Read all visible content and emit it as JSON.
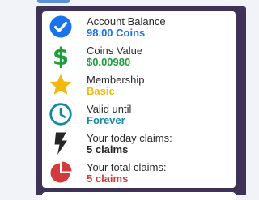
{
  "colors": {
    "page_bg": "#f1f3f8",
    "panel_bg": "#3e3256",
    "card_bg": "#ffffff",
    "blue": "#1a73e8",
    "green": "#1f9d3a",
    "yellow": "#f2b90c",
    "teal": "#138aa3",
    "dark": "#262626",
    "red": "#d23b3b"
  },
  "stats": [
    {
      "label": "Account Balance",
      "value": "98.00 Coins",
      "icon": "check-circle-icon",
      "color": "#1a73e8"
    },
    {
      "label": "Coins Value",
      "value": "$0.00980",
      "icon": "dollar-icon",
      "color": "#1f9d3a"
    },
    {
      "label": "Membership",
      "value": "Basic",
      "icon": "star-icon",
      "color": "#f2b90c"
    },
    {
      "label": "Valid until",
      "value": "Forever",
      "icon": "clock-icon",
      "color": "#138aa3"
    },
    {
      "label": "Your today claims:",
      "value": "5 claims",
      "icon": "bolt-icon",
      "color": "#262626"
    },
    {
      "label": "Your total claims:",
      "value": "5 claims",
      "icon": "pie-chart-icon",
      "color": "#d23b3b"
    }
  ]
}
